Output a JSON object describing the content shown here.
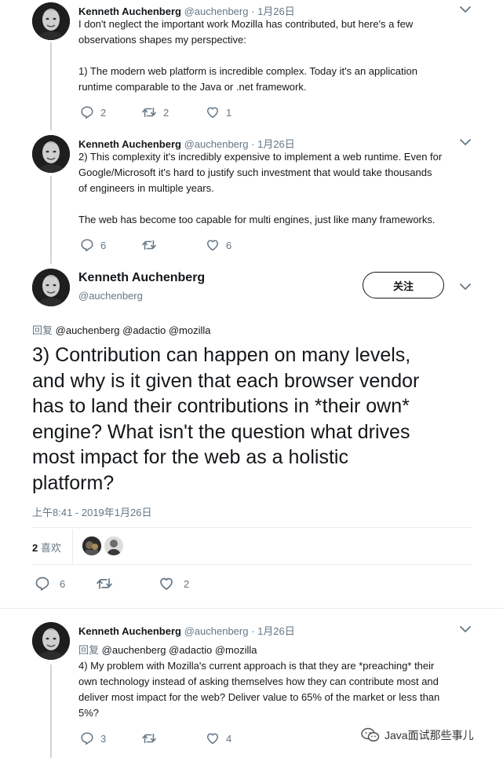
{
  "tweet1": {
    "name": "Kenneth Auchenberg",
    "handle": "@auchenberg",
    "date": "1月26日",
    "lines": [
      "I don't neglect the important work Mozilla has contributed, but here's a few",
      "observations shapes my perspective:",
      "",
      "1) The modern web platform is incredible complex. Today it's an application",
      "runtime comparable to the Java or .net framework."
    ],
    "replies": "2",
    "retweets": "2",
    "likes": "1"
  },
  "tweet2": {
    "name": "Kenneth Auchenberg",
    "handle": "@auchenberg",
    "date": "1月26日",
    "lines": [
      "2) This complexity it's incredibly expensive to implement a web runtime. Even for",
      "Google/Microsoft it's hard to justify such investment that would take thousands",
      "of engineers in multiple years.",
      "",
      "The web has become too capable for multi engines, just like many frameworks."
    ],
    "replies": "6",
    "retweets": "",
    "likes": "6"
  },
  "main_tweet": {
    "name": "Kenneth Auchenberg",
    "handle": "@auchenberg",
    "follow_label": "关注",
    "reply_prefix": "回复",
    "reply_to": "@auchenberg @adactio @mozilla",
    "lines": [
      "3) Contribution can happen on many levels,",
      "and why is it given that each browser vendor",
      "has to land their contributions in *their own*",
      "engine? What isn't the question what drives",
      "most impact for the web as a holistic",
      "platform?"
    ],
    "timestamp": "上午8:41 - 2019年1月26日",
    "likes_count": "2",
    "likes_label": "喜欢",
    "replies": "6",
    "retweets": "",
    "likes": "2"
  },
  "tweet4": {
    "name": "Kenneth Auchenberg",
    "handle": "@auchenberg",
    "date": "1月26日",
    "reply_prefix": "回复",
    "reply_to": "@auchenberg @adactio @mozilla",
    "lines": [
      "4) My problem with Mozilla's current approach is that they are *preaching* their",
      "own technology instead of asking themselves how they can contribute most and",
      "deliver most impact for the web? Deliver value to 65% of the market or less than",
      "5%?"
    ],
    "replies": "3",
    "retweets": "",
    "likes": "4"
  },
  "watermark": "Java面试那些事儿",
  "colors": {
    "text": "#14171a",
    "meta": "#657786",
    "line": "#ccd6dd",
    "accent": "#1da1f2"
  }
}
